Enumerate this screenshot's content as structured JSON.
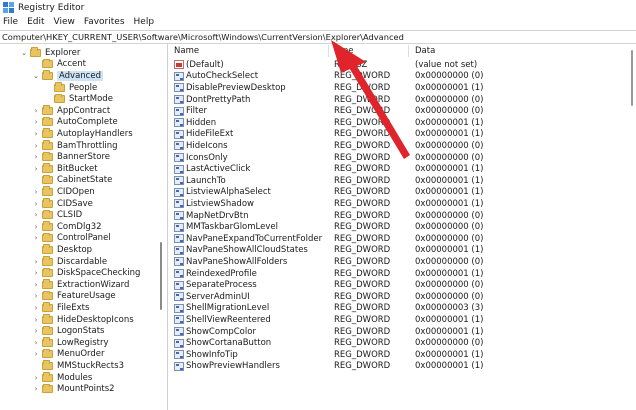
{
  "window": {
    "title": "Registry Editor"
  },
  "menu": [
    "File",
    "Edit",
    "View",
    "Favorites",
    "Help"
  ],
  "address": "Computer\\HKEY_CURRENT_USER\\Software\\Microsoft\\Windows\\CurrentVersion\\Explorer\\Advanced",
  "tree": [
    {
      "label": "Explorer",
      "level": 0,
      "chevron": "down"
    },
    {
      "label": "Accent",
      "level": 1,
      "chevron": "none"
    },
    {
      "label": "Advanced",
      "level": 1,
      "chevron": "down",
      "selected": true
    },
    {
      "label": "People",
      "level": 2,
      "chevron": "none"
    },
    {
      "label": "StartMode",
      "level": 2,
      "chevron": "none"
    },
    {
      "label": "AppContract",
      "level": 1,
      "chevron": "right"
    },
    {
      "label": "AutoComplete",
      "level": 1,
      "chevron": "right"
    },
    {
      "label": "AutoplayHandlers",
      "level": 1,
      "chevron": "right"
    },
    {
      "label": "BamThrottling",
      "level": 1,
      "chevron": "right"
    },
    {
      "label": "BannerStore",
      "level": 1,
      "chevron": "right"
    },
    {
      "label": "BitBucket",
      "level": 1,
      "chevron": "right"
    },
    {
      "label": "CabinetState",
      "level": 1,
      "chevron": "none"
    },
    {
      "label": "CIDOpen",
      "level": 1,
      "chevron": "right"
    },
    {
      "label": "CIDSave",
      "level": 1,
      "chevron": "right"
    },
    {
      "label": "CLSID",
      "level": 1,
      "chevron": "right"
    },
    {
      "label": "ComDlg32",
      "level": 1,
      "chevron": "right"
    },
    {
      "label": "ControlPanel",
      "level": 1,
      "chevron": "right"
    },
    {
      "label": "Desktop",
      "level": 1,
      "chevron": "none"
    },
    {
      "label": "Discardable",
      "level": 1,
      "chevron": "right"
    },
    {
      "label": "DiskSpaceChecking",
      "level": 1,
      "chevron": "right"
    },
    {
      "label": "ExtractionWizard",
      "level": 1,
      "chevron": "right"
    },
    {
      "label": "FeatureUsage",
      "level": 1,
      "chevron": "right"
    },
    {
      "label": "FileExts",
      "level": 1,
      "chevron": "right"
    },
    {
      "label": "HideDesktopIcons",
      "level": 1,
      "chevron": "right"
    },
    {
      "label": "LogonStats",
      "level": 1,
      "chevron": "right"
    },
    {
      "label": "LowRegistry",
      "level": 1,
      "chevron": "right"
    },
    {
      "label": "MenuOrder",
      "level": 1,
      "chevron": "right"
    },
    {
      "label": "MMStuckRects3",
      "level": 1,
      "chevron": "none"
    },
    {
      "label": "Modules",
      "level": 1,
      "chevron": "right"
    },
    {
      "label": "MountPoints2",
      "level": 1,
      "chevron": "right"
    }
  ],
  "columns": {
    "name": "Name",
    "type": "Type",
    "data": "Data"
  },
  "values": [
    {
      "name": "(Default)",
      "type": "REG_SZ",
      "data": "(value not set)",
      "icon": "string"
    },
    {
      "name": "AutoCheckSelect",
      "type": "REG_DWORD",
      "data": "0x00000000 (0)",
      "icon": "binary"
    },
    {
      "name": "DisablePreviewDesktop",
      "type": "REG_DWORD",
      "data": "0x00000001 (1)",
      "icon": "binary"
    },
    {
      "name": "DontPrettyPath",
      "type": "REG_DWORD",
      "data": "0x00000000 (0)",
      "icon": "binary"
    },
    {
      "name": "Filter",
      "type": "REG_DWORD",
      "data": "0x00000000 (0)",
      "icon": "binary"
    },
    {
      "name": "Hidden",
      "type": "REG_DWORD",
      "data": "0x00000001 (1)",
      "icon": "binary"
    },
    {
      "name": "HideFileExt",
      "type": "REG_DWORD",
      "data": "0x00000001 (1)",
      "icon": "binary"
    },
    {
      "name": "HideIcons",
      "type": "REG_DWORD",
      "data": "0x00000000 (0)",
      "icon": "binary"
    },
    {
      "name": "IconsOnly",
      "type": "REG_DWORD",
      "data": "0x00000000 (0)",
      "icon": "binary"
    },
    {
      "name": "LastActiveClick",
      "type": "REG_DWORD",
      "data": "0x00000001 (1)",
      "icon": "binary"
    },
    {
      "name": "LaunchTo",
      "type": "REG_DWORD",
      "data": "0x00000001 (1)",
      "icon": "binary"
    },
    {
      "name": "ListviewAlphaSelect",
      "type": "REG_DWORD",
      "data": "0x00000001 (1)",
      "icon": "binary"
    },
    {
      "name": "ListviewShadow",
      "type": "REG_DWORD",
      "data": "0x00000001 (1)",
      "icon": "binary"
    },
    {
      "name": "MapNetDrvBtn",
      "type": "REG_DWORD",
      "data": "0x00000000 (0)",
      "icon": "binary"
    },
    {
      "name": "MMTaskbarGlomLevel",
      "type": "REG_DWORD",
      "data": "0x00000000 (0)",
      "icon": "binary"
    },
    {
      "name": "NavPaneExpandToCurrentFolder",
      "type": "REG_DWORD",
      "data": "0x00000000 (0)",
      "icon": "binary"
    },
    {
      "name": "NavPaneShowAllCloudStates",
      "type": "REG_DWORD",
      "data": "0x00000001 (1)",
      "icon": "binary"
    },
    {
      "name": "NavPaneShowAllFolders",
      "type": "REG_DWORD",
      "data": "0x00000000 (0)",
      "icon": "binary"
    },
    {
      "name": "ReindexedProfile",
      "type": "REG_DWORD",
      "data": "0x00000001 (1)",
      "icon": "binary"
    },
    {
      "name": "SeparateProcess",
      "type": "REG_DWORD",
      "data": "0x00000000 (0)",
      "icon": "binary"
    },
    {
      "name": "ServerAdminUI",
      "type": "REG_DWORD",
      "data": "0x00000000 (0)",
      "icon": "binary"
    },
    {
      "name": "ShellMigrationLevel",
      "type": "REG_DWORD",
      "data": "0x00000003 (3)",
      "icon": "binary"
    },
    {
      "name": "ShellViewReentered",
      "type": "REG_DWORD",
      "data": "0x00000001 (1)",
      "icon": "binary"
    },
    {
      "name": "ShowCompColor",
      "type": "REG_DWORD",
      "data": "0x00000001 (1)",
      "icon": "binary"
    },
    {
      "name": "ShowCortanaButton",
      "type": "REG_DWORD",
      "data": "0x00000000 (0)",
      "icon": "binary"
    },
    {
      "name": "ShowInfoTip",
      "type": "REG_DWORD",
      "data": "0x00000001 (1)",
      "icon": "binary"
    },
    {
      "name": "ShowPreviewHandlers",
      "type": "REG_DWORD",
      "data": "0x00000001 (1)",
      "icon": "binary"
    }
  ],
  "colors": {
    "selection": "#cde4f7",
    "arrow": "#e0242b",
    "folder": "#e9c462"
  },
  "annotation": {
    "type": "arrow-icon",
    "color": "#e0242b"
  }
}
